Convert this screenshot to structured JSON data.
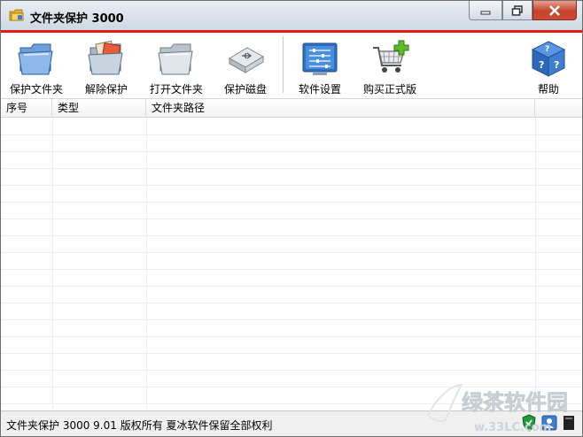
{
  "window": {
    "title": "文件夹保护 3000"
  },
  "toolbar": {
    "items": [
      {
        "label": "保护文件夹",
        "icon": "folder-protect-icon"
      },
      {
        "label": "解除保护",
        "icon": "folder-unprotect-icon"
      },
      {
        "label": "打开文件夹",
        "icon": "folder-open-icon"
      },
      {
        "label": "保护磁盘",
        "icon": "usb-disk-icon"
      },
      {
        "label": "软件设置",
        "icon": "settings-panel-icon"
      },
      {
        "label": "购买正式版",
        "icon": "shopping-cart-icon"
      },
      {
        "label": "帮助",
        "icon": "help-cube-icon"
      }
    ]
  },
  "table": {
    "columns": [
      "序号",
      "类型",
      "文件夹路径"
    ],
    "rows": []
  },
  "status": {
    "text": "文件夹保护 3000 9.01 版权所有 夏冰软件保留全部权利"
  },
  "watermark": {
    "text": "绿茶软件园",
    "url": "w.33LC.com"
  },
  "colors": {
    "accent": "#e21a1a",
    "close_button": "#c5422b"
  }
}
